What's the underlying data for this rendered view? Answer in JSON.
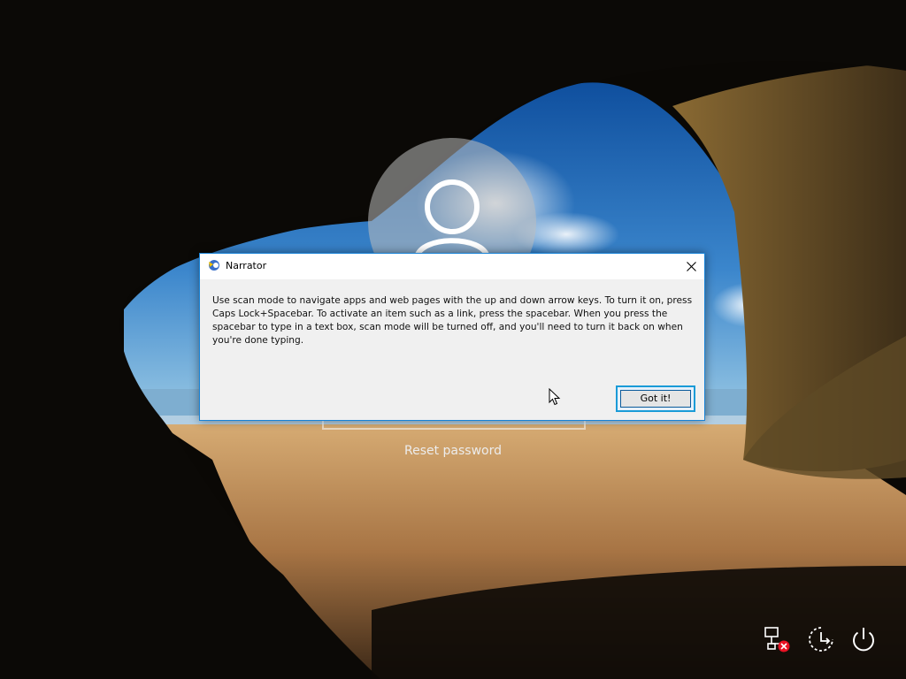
{
  "lock_screen": {
    "reset_password_label": "Reset password"
  },
  "dialog": {
    "title": "Narrator",
    "app_icon": "narrator-icon",
    "close_icon": "close-icon",
    "message": "Use scan mode to navigate apps and web pages with the up and down arrow keys. To turn it on, press Caps Lock+Spacebar. To activate an item such as a link, press the spacebar. When you press the spacebar to type in a text box, scan mode will be turned off, and you'll need to turn it back on when you're done typing.",
    "button_label": "Got it!"
  },
  "system_tray": {
    "icons": [
      "network-disconnected-icon",
      "ease-of-access-icon",
      "power-icon"
    ]
  },
  "colors": {
    "dialog_border": "#1883d7",
    "button_focus": "#1a9bd7",
    "error_badge": "#e81123"
  }
}
